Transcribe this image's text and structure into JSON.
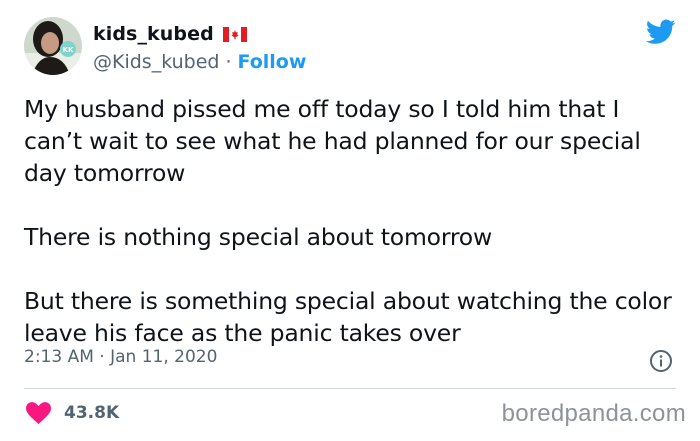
{
  "tweet": {
    "author": {
      "display_name": "kids_kubed",
      "flag_icon": "canada-flag-icon",
      "handle": "@Kids_kubed",
      "separator": "·",
      "follow_label": "Follow"
    },
    "paragraphs": [
      "My husband pissed me off today so I told him that I can’t wait to see what he had planned for our special day tomorrow",
      "There is nothing special about tomorrow",
      "But there is something special about watching the color leave his face as the panic takes over"
    ],
    "timestamp": "2:13 AM · Jan 11, 2020",
    "likes": "43.8K"
  },
  "icons": {
    "platform": "twitter-bird-icon",
    "info": "info-icon",
    "like": "heart-icon"
  },
  "watermark": "boredpanda.com",
  "colors": {
    "accent": "#1d9bf0",
    "like": "#f91880",
    "muted_text": "#536471",
    "text": "#0f1419"
  }
}
